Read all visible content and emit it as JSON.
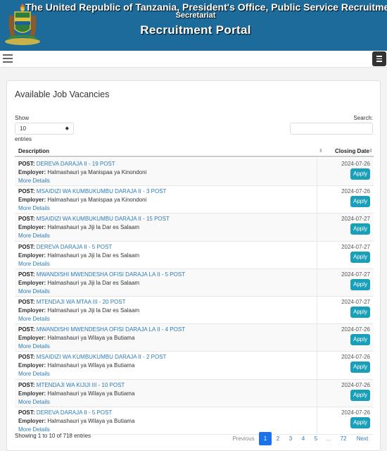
{
  "header": {
    "line1": "The United Republic of Tanzania, President's Office, Public Service Recruitment",
    "line2": "Secretariat",
    "portal": "Recruitment Portal"
  },
  "card": {
    "title": "Available Job Vacancies",
    "show_label": "Show",
    "length_value": "10",
    "entries_label": "entries",
    "search_label": "Search:",
    "search_value": ""
  },
  "table": {
    "col_description": "Description",
    "col_closing": "Closing Date",
    "post_label": "POST:",
    "employer_label": "Employer:",
    "more_label": "More Details",
    "apply_label": "Apply",
    "rows": [
      {
        "post": "DEREVA DARAJA II - 19 POST",
        "employer": "Halmashauri ya Manispaa ya Kinondoni",
        "date": "2024-07-26"
      },
      {
        "post": "MSAIDIZI WA KUMBUKUMBU DARAJA II - 3 POST",
        "employer": "Halmashauri ya Manispaa ya Kinondoni",
        "date": "2024-07-26"
      },
      {
        "post": "MSAIDIZI WA KUMBUKUMBU DARAJA II - 15 POST",
        "employer": "Halmashauri ya Jiji la Dar es Salaam",
        "date": "2024-07-27"
      },
      {
        "post": "DEREVA DARAJA II - 5 POST",
        "employer": "Halmashauri ya Jiji la Dar es Salaam",
        "date": "2024-07-27"
      },
      {
        "post": "MWANDISHI MWENDESHA OFISI DARAJA LA II - 5 POST",
        "employer": "Halmashauri ya Jiji la Dar es Salaam",
        "date": "2024-07-27"
      },
      {
        "post": "MTENDAJI WA MTAA III - 20 POST",
        "employer": "Halmashauri ya Jiji la Dar es Salaam",
        "date": "2024-07-27"
      },
      {
        "post": "MWANDISHI MWENDESHA OFISI DARAJA LA II - 4 POST",
        "employer": "Halmashauri ya Wilaya ya Butiama",
        "date": "2024-07-26"
      },
      {
        "post": "MSAIDIZI WA KUMBUKUMBU DARAJA II - 2 POST",
        "employer": "Halmashauri ya Wilaya ya Butiama",
        "date": "2024-07-26"
      },
      {
        "post": "MTENDAJI WA KIJIJI III - 10 POST",
        "employer": "Halmashauri ya Wilaya ya Butiama",
        "date": "2024-07-26"
      },
      {
        "post": "DEREVA DARAJA II - 5 POST",
        "employer": "Halmashauri ya Wilaya ya Butiama",
        "date": "2024-07-26"
      }
    ]
  },
  "footer": {
    "info": "Showing 1 to 10 of 718 entries",
    "pagination": [
      "Previous",
      "1",
      "2",
      "3",
      "4",
      "5",
      "…",
      "72",
      "Next"
    ]
  },
  "colors": {
    "header_bg": "#1c6b9a",
    "apply_bg": "#1a9fb8",
    "link": "#2b7bb9",
    "active_page": "#1a73e8"
  },
  "icons": {
    "logo": "coat-of-arms-icon",
    "nav_left": "hamburger-icon",
    "nav_right": "menu-icon"
  }
}
